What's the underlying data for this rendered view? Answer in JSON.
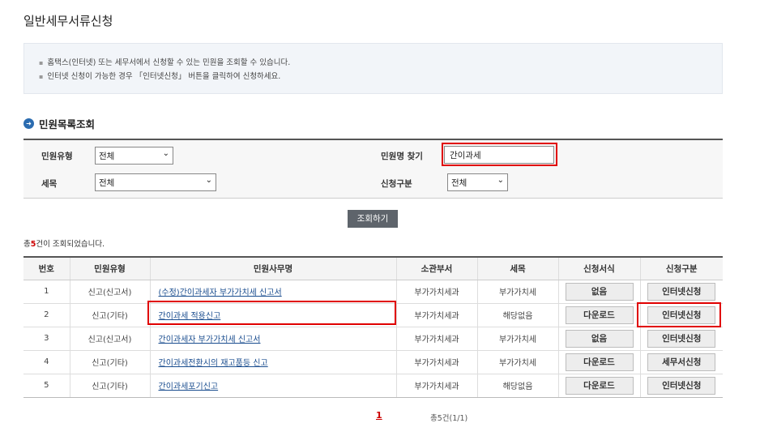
{
  "page": {
    "title": "일반세무서류신청"
  },
  "notice": {
    "items": [
      "홈택스(인터넷) 또는 세무서에서 신청할 수 있는 민원을 조회할 수 있습니다.",
      "인터넷 신청이 가능한 경우 「인터넷신청」 버튼을 클릭하여 신청하세요."
    ]
  },
  "section": {
    "title": "민원목록조회",
    "bullet_icon": "arrow-right-circle-icon"
  },
  "search": {
    "type_label": "민원유형",
    "type_value": "전체",
    "tax_label": "세목",
    "tax_value": "전체",
    "name_label": "민원명 찾기",
    "name_value": "간이과세",
    "apply_label": "신청구분",
    "apply_value": "전체",
    "button_label": "조회하기"
  },
  "result": {
    "prefix": "총",
    "count": "5",
    "suffix": "건이 조회되었습니다."
  },
  "table": {
    "headers": [
      "번호",
      "민원유형",
      "민원사무명",
      "소관부서",
      "세목",
      "신청서식",
      "신청구분"
    ],
    "rows": [
      {
        "no": "1",
        "type": "신고(신고서)",
        "name": "(수정)간이과세자 부가가치세 신고서",
        "dept": "부가가치세과",
        "tax": "부가가치세",
        "form": "없음",
        "apply": "인터넷신청"
      },
      {
        "no": "2",
        "type": "신고(기타)",
        "name": "간이과세 적용신고",
        "dept": "부가가치세과",
        "tax": "해당없음",
        "form": "다운로드",
        "apply": "인터넷신청"
      },
      {
        "no": "3",
        "type": "신고(신고서)",
        "name": "간이과세자 부가가치세 신고서",
        "dept": "부가가치세과",
        "tax": "부가가치세",
        "form": "없음",
        "apply": "인터넷신청"
      },
      {
        "no": "4",
        "type": "신고(기타)",
        "name": "간이과세전환시의 재고품등 신고",
        "dept": "부가가치세과",
        "tax": "부가가치세",
        "form": "다운로드",
        "apply": "세무서신청"
      },
      {
        "no": "5",
        "type": "신고(기타)",
        "name": "간이과세포기신고",
        "dept": "부가가치세과",
        "tax": "해당없음",
        "form": "다운로드",
        "apply": "인터넷신청"
      }
    ]
  },
  "pagination": {
    "current": "1",
    "info": "총5건(1/1)"
  }
}
